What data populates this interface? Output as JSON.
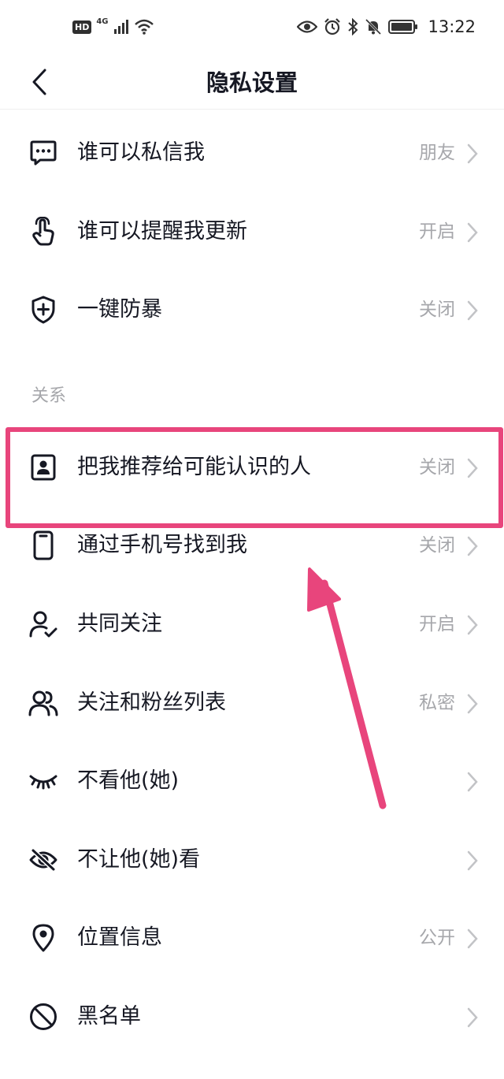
{
  "status_bar": {
    "hd": "HD",
    "network": "4G",
    "time": "13:22"
  },
  "nav": {
    "title": "隐私设置",
    "back_icon": "chevron-left-icon"
  },
  "section_relationship": "关系",
  "items_top": [
    {
      "name": "who-can-message-me",
      "icon": "message-icon",
      "label": "谁可以私信我",
      "value": "朋友"
    },
    {
      "name": "who-can-remind-me",
      "icon": "tap-hand-icon",
      "label": "谁可以提醒我更新",
      "value": "开启"
    },
    {
      "name": "anti-harassment",
      "icon": "shield-plus-icon",
      "label": "一键防暴",
      "value": "关闭"
    }
  ],
  "items_relationship": [
    {
      "name": "recommend-me",
      "icon": "contact-card-icon",
      "label": "把我推荐给可能认识的人",
      "value": "关闭"
    },
    {
      "name": "find-by-phone",
      "icon": "phone-icon",
      "label": "通过手机号找到我",
      "value": "关闭"
    },
    {
      "name": "mutual-follows",
      "icon": "user-check-icon",
      "label": "共同关注",
      "value": "开启"
    },
    {
      "name": "follow-fans-list",
      "icon": "users-icon",
      "label": "关注和粉丝列表",
      "value": "私密"
    },
    {
      "name": "hide-their-content",
      "icon": "closed-eye-icon",
      "label": "不看他(她)",
      "value": ""
    },
    {
      "name": "hide-from-them",
      "icon": "eye-off-icon",
      "label": "不让他(她)看",
      "value": ""
    },
    {
      "name": "location-info",
      "icon": "location-pin-icon",
      "label": "位置信息",
      "value": "公开"
    },
    {
      "name": "blacklist",
      "icon": "block-icon",
      "label": "黑名单",
      "value": ""
    }
  ],
  "colors": {
    "text": "#161823",
    "secondary": "#a6a7ab",
    "highlight": "#e8457c"
  }
}
